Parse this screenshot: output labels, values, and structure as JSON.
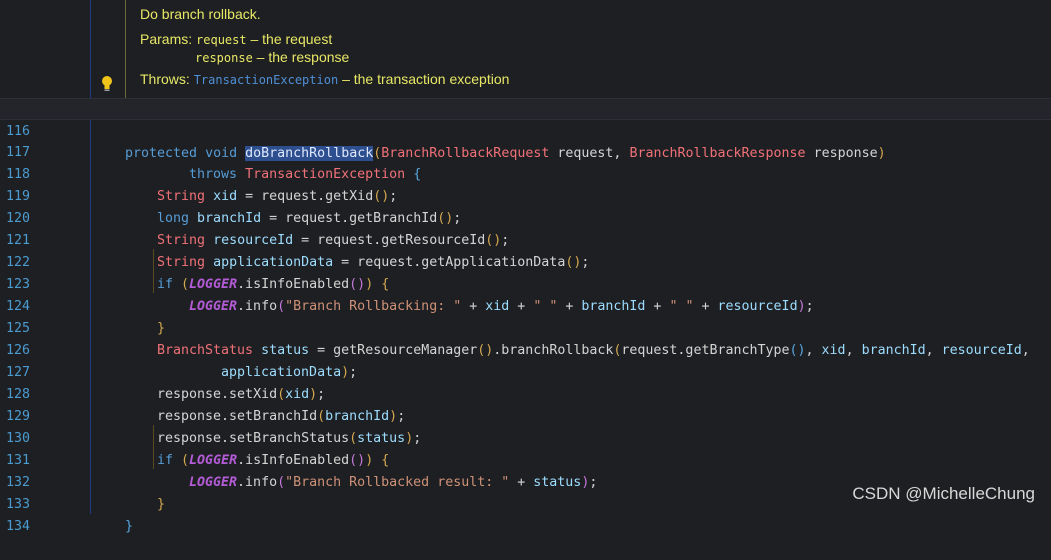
{
  "doc": {
    "summary": "Do branch rollback.",
    "params_label": "Params:",
    "param1_name": "request",
    "param1_desc": " – the request",
    "param2_name": "response",
    "param2_desc": " – the response",
    "throws_label": "Throws:",
    "throws_type": "TransactionException",
    "throws_desc": " – the transaction exception"
  },
  "lines": [
    {
      "n": "116"
    },
    {
      "n": "117"
    },
    {
      "n": "118"
    },
    {
      "n": "119"
    },
    {
      "n": "120"
    },
    {
      "n": "121"
    },
    {
      "n": "122"
    },
    {
      "n": "123"
    },
    {
      "n": "124"
    },
    {
      "n": "125"
    },
    {
      "n": "126"
    },
    {
      "n": "127"
    },
    {
      "n": "128"
    },
    {
      "n": "129"
    },
    {
      "n": "130"
    },
    {
      "n": "131"
    },
    {
      "n": "132"
    },
    {
      "n": "133"
    },
    {
      "n": "134"
    }
  ],
  "code": {
    "l116_kw1": "protected",
    "l116_kw2": "void",
    "l116_method": "doBranchRollback",
    "l116_t1": "BranchRollbackRequest",
    "l116_p1": "request",
    "l116_t2": "BranchRollbackResponse",
    "l116_p2": "response",
    "l117_kw": "throws",
    "l117_ex": "TransactionException",
    "l118": "String xid = request.getXid();",
    "l119": "long branchId = request.getBranchId();",
    "l120": "String resourceId = request.getResourceId();",
    "l121": "String applicationData = request.getApplicationData();",
    "l122": "if (LOGGER.isInfoEnabled()) {",
    "l123_str1": "\"Branch Rollbacking: \"",
    "l123_str2": "\" \"",
    "l123_str3": "\" \"",
    "l125_a": "BranchStatus status = getResourceManager().branchRollback(request.getBranchType(), xid, branchId, resourceId,",
    "l126": "applicationData);",
    "l127": "response.setXid(xid);",
    "l128": "response.setBranchId(branchId);",
    "l129": "response.setBranchStatus(status);",
    "l130": "if (LOGGER.isInfoEnabled()) {",
    "l131_str": "\"Branch Rollbacked result: \"",
    "l132": "}",
    "l133": "}",
    "logger": "LOGGER",
    "info": ".info"
  },
  "watermark": "CSDN @MichelleChung",
  "colors": {
    "background": "#1e1f22",
    "line_numbers": "#4b9bd1",
    "doc_text": "#e8e866",
    "selection": "#2d4f8f"
  },
  "icons": {
    "bulb": "lightbulb-icon"
  }
}
